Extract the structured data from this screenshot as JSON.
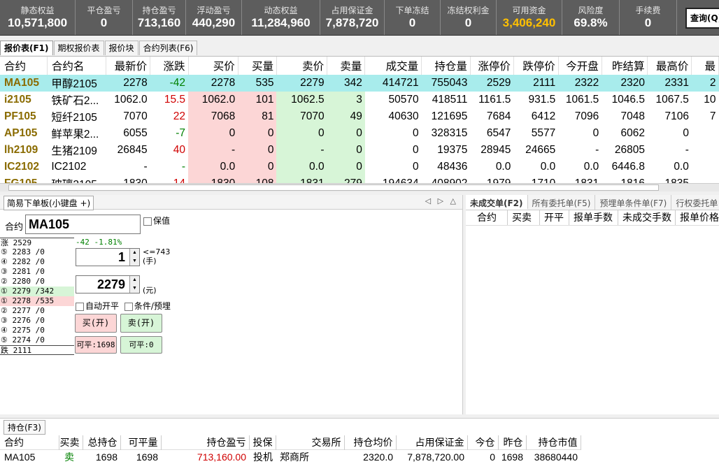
{
  "account": {
    "stats": [
      {
        "label": "静态权益",
        "value": "10,571,800"
      },
      {
        "label": "平仓盈亏",
        "value": "0"
      },
      {
        "label": "持仓盈亏",
        "value": "713,160"
      },
      {
        "label": "浮动盈亏",
        "value": "440,290"
      },
      {
        "label": "动态权益",
        "value": "11,284,960"
      },
      {
        "label": "占用保证金",
        "value": "7,878,720"
      },
      {
        "label": "下单冻结",
        "value": "0"
      },
      {
        "label": "冻结权利金",
        "value": "0"
      },
      {
        "label": "可用资金",
        "value": "3,406,240"
      },
      {
        "label": "风险度",
        "value": "69.8%"
      },
      {
        "label": "手续费",
        "value": "0"
      }
    ],
    "query_button": "查询(Q)"
  },
  "tabs": [
    "报价表(F1)",
    "期权报价表",
    "报价块",
    "合约列表(F6)"
  ],
  "quote_table": {
    "headers": [
      "合约",
      "合约名",
      "最新价",
      "涨跌",
      "买价",
      "买量",
      "卖价",
      "卖量",
      "成交量",
      "持仓量",
      "涨停价",
      "跌停价",
      "今开盘",
      "昨结算",
      "最高价",
      "最"
    ],
    "rows": [
      [
        "MA105",
        "甲醇2105",
        "2278",
        "-42",
        "2278",
        "535",
        "2279",
        "342",
        "414721",
        "755043",
        "2529",
        "2111",
        "2322",
        "2320",
        "2331",
        "2"
      ],
      [
        "i2105",
        "铁矿石2...",
        "1062.0",
        "15.5",
        "1062.0",
        "101",
        "1062.5",
        "3",
        "50570",
        "418511",
        "1161.5",
        "931.5",
        "1061.5",
        "1046.5",
        "1067.5",
        "10"
      ],
      [
        "PF105",
        "短纤2105",
        "7070",
        "22",
        "7068",
        "81",
        "7070",
        "49",
        "40630",
        "121695",
        "7684",
        "6412",
        "7096",
        "7048",
        "7106",
        "7"
      ],
      [
        "AP105",
        "鲜苹果2...",
        "6055",
        "-7",
        "0",
        "0",
        "0",
        "0",
        "0",
        "328315",
        "6547",
        "5577",
        "0",
        "6062",
        "0",
        ""
      ],
      [
        "lh2109",
        "生猪2109",
        "26845",
        "40",
        "-",
        "0",
        "-",
        "0",
        "0",
        "19375",
        "28945",
        "24665",
        "-",
        "26805",
        "-",
        ""
      ],
      [
        "IC2102",
        "IC2102",
        "-",
        "-",
        "0.0",
        "0",
        "0.0",
        "0",
        "0",
        "48436",
        "0.0",
        "0.0",
        "0.0",
        "6446.8",
        "0.0",
        ""
      ],
      [
        "FG105",
        "玻璃2105",
        "1830",
        "14",
        "1830",
        "108",
        "1831",
        "279",
        "194634",
        "408902",
        "1979",
        "1710",
        "1831",
        "1816",
        "1835",
        ""
      ]
    ]
  },
  "order_panel": {
    "title": "简易下单板(小键盘 +)",
    "contract_label": "合约",
    "contract_value": "MA105",
    "hedge_label": "保值",
    "ladder": {
      "limit_up": "涨 2529",
      "change": "-42 -1.81%",
      "asks": [
        "⑤ 2283 /0",
        "④ 2282 /0",
        "③ 2281 /0",
        "② 2280 /0",
        "① 2279 /342"
      ],
      "bids": [
        "① 2278 /535",
        "② 2277 /0",
        "③ 2276 /0",
        "④ 2275 /0",
        "⑤ 2274 /0"
      ],
      "limit_down": "跌 2111"
    },
    "qty_value": "1",
    "qty_max": "<=743",
    "qty_unit": "(手)",
    "price_value": "2279",
    "price_unit": "(元)",
    "auto_open_close": "自动开平",
    "condition_preorder": "条件/预埋",
    "buy_open": "买(开)",
    "sell_open": "卖(开)",
    "can_close_buy": "可平:1698",
    "can_close_sell": "可平:0"
  },
  "pending_panel": {
    "tabs": [
      "未成交单(F2)",
      "所有委托单(F5)",
      "预埋单条件单(F7)",
      "行权委托单"
    ],
    "headers": [
      "合约",
      "买卖",
      "开平",
      "报单手数",
      "未成交手数",
      "报单价格"
    ]
  },
  "positions": {
    "tab": "持仓(F3)",
    "headers": [
      "合约",
      "买卖",
      "总持仓",
      "可平量",
      "持仓盈亏",
      "投保",
      "交易所",
      "持仓均价",
      "占用保证金",
      "今仓",
      "昨仓",
      "持仓市值"
    ],
    "rows": [
      [
        "MA105",
        "卖",
        "1698",
        "1698",
        "713,160.00",
        "投机",
        "郑商所",
        "2320.0",
        "7,878,720.00",
        "0",
        "1698",
        "38680440"
      ]
    ]
  },
  "colors": {
    "up": "#d00000",
    "down": "#008000",
    "highlight": "#a8ecec",
    "available_funds": "#ffc000"
  }
}
